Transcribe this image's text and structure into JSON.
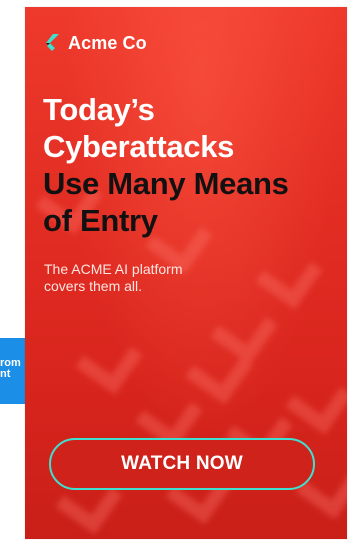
{
  "ad": {
    "brand_name": "Acme Co",
    "logo_icon": "acme-chevron-logo",
    "headline_lines": [
      {
        "text": "Today’s",
        "color": "#ffffff"
      },
      {
        "text": "Cyberattacks",
        "color": "#ffffff"
      },
      {
        "text": "Use Many Means",
        "color": "#111111"
      },
      {
        "text": "of Entry",
        "color": "#111111"
      }
    ],
    "subtext_line1": "The ACME AI platform",
    "subtext_line2": "covers them all.",
    "cta_label": "WATCH NOW",
    "colors": {
      "background": "#e52b22",
      "accent": "#40e0d0",
      "tab": "#1b8fe8"
    }
  },
  "side_tab": {
    "line1": "rom",
    "line2": "nt"
  }
}
